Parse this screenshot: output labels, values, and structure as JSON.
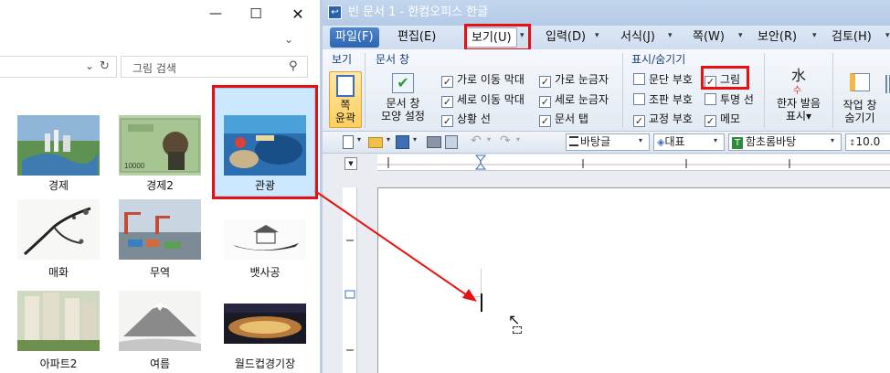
{
  "explorer": {
    "search_placeholder": "그림 검색",
    "items": [
      {
        "label": "경제"
      },
      {
        "label": "경제2"
      },
      {
        "label": "관광"
      },
      {
        "label": "매화"
      },
      {
        "label": "무역"
      },
      {
        "label": "뱃사공"
      },
      {
        "label": "아파트2"
      },
      {
        "label": "여름"
      },
      {
        "label": "월드컵경기장"
      }
    ],
    "selected_item": "관광",
    "banknote_value": "10000"
  },
  "hwp": {
    "title": "빈 문서 1 - 한컴오피스 한글",
    "menus": {
      "file": "파일(F)",
      "edit": "편집(E)",
      "view": "보기(U)",
      "input": "입력(D)",
      "format": "서식(J)",
      "page": "쪽(W)",
      "security": "보안(R)",
      "review": "검토(H)"
    },
    "ribbon": {
      "group_view": "보기",
      "group_docwin": "문서 창",
      "group_showhide": "표시/숨기기",
      "outline_btn_1": "쪽",
      "outline_btn_2": "윤곽",
      "docwin_btn_1": "문서 창",
      "docwin_btn_2": "모양 설정",
      "hanja_btn_1": "한자 발음",
      "hanja_btn_2": "표시▾",
      "hanja_glyph": "水",
      "hanja_glyph_sub": "수",
      "taskwin_btn_1": "작업 창",
      "taskwin_btn_2": "숨기기",
      "checkboxes": {
        "h_scroll": {
          "label": "가로 이동 막대",
          "checked": true
        },
        "v_scroll": {
          "label": "세로 이동 막대",
          "checked": true
        },
        "status_bar": {
          "label": "상황 선",
          "checked": true
        },
        "h_ruler": {
          "label": "가로 눈금자",
          "checked": true
        },
        "v_ruler": {
          "label": "세로 눈금자",
          "checked": true
        },
        "doc_tab": {
          "label": "문서 탭",
          "checked": true
        },
        "para_mark": {
          "label": "문단 부호",
          "checked": false
        },
        "control_mark": {
          "label": "조판 부호",
          "checked": false
        },
        "edit_mark": {
          "label": "교정 부호",
          "checked": true
        },
        "picture": {
          "label": "그림",
          "checked": true
        },
        "transparent_line": {
          "label": "투명 선",
          "checked": false
        },
        "memo": {
          "label": "메모",
          "checked": true
        }
      }
    },
    "toolbar": {
      "style": "바탕글",
      "lang": "대표",
      "font": "함초롬바탕",
      "font_glyph": "T",
      "size": "10.0"
    }
  },
  "colors": {
    "highlight_red": "#e81010",
    "selection_blue": "#cce8ff",
    "menu_file_blue": "#2c64b0"
  }
}
